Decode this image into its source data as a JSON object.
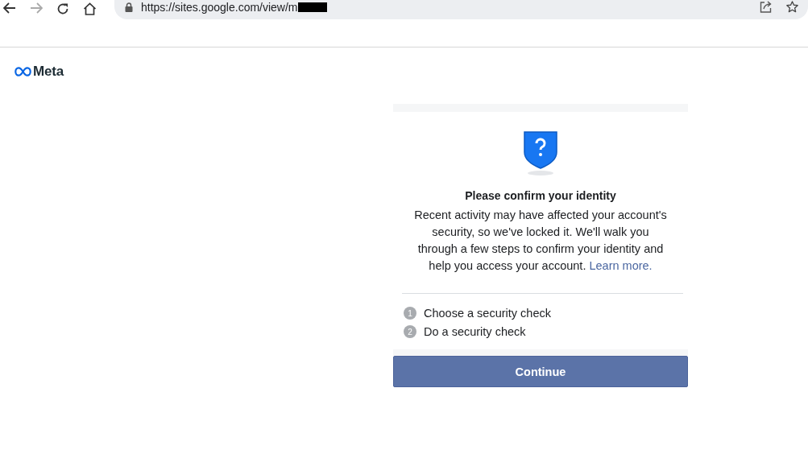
{
  "browser": {
    "url": "https://sites.google.com/view/m",
    "url_redacted": true
  },
  "brand": {
    "name": "Meta"
  },
  "card": {
    "title": "Please confirm your identity",
    "body": "Recent activity may have affected your account's security, so we've locked it. We'll walk you through a few steps to confirm your identity and help you access your account.",
    "link": "Learn more.",
    "steps": [
      {
        "number": "1",
        "label": "Choose a security check"
      },
      {
        "number": "2",
        "label": "Do a security check"
      }
    ],
    "button": "Continue"
  }
}
